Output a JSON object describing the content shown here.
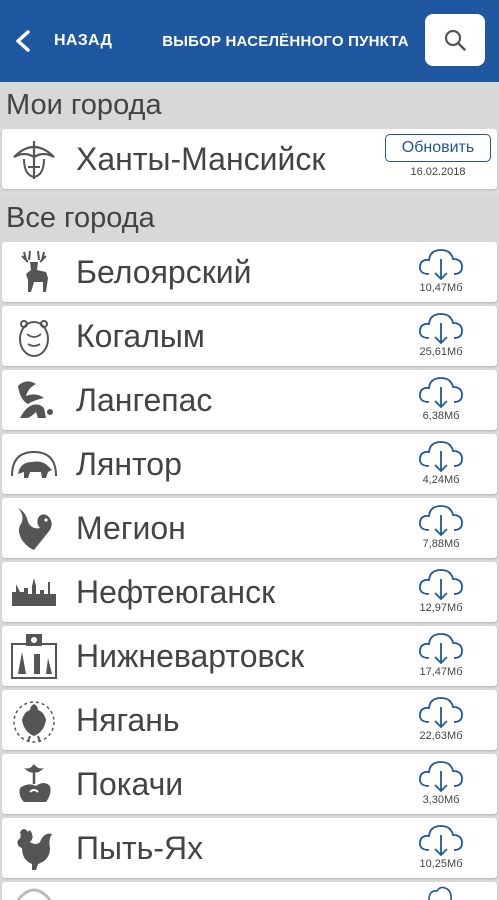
{
  "header": {
    "back_label": "НАЗАД",
    "title": "ВЫБОР НАСЕЛЁННОГО ПУНКТА",
    "accent_color": "#1f57a0"
  },
  "my_cities": {
    "title": "Мои города",
    "items": [
      {
        "name": "Ханты-Мансийск",
        "update_label": "Обновить",
        "date": "16.02.2018",
        "icon": "khanty-mansiysk-emblem-icon"
      }
    ]
  },
  "all_cities": {
    "title": "Все города",
    "items": [
      {
        "name": "Белоярский",
        "size": "10,47Мб",
        "icon": "deer-icon"
      },
      {
        "name": "Когалым",
        "size": "25,61Мб",
        "icon": "bear-icon"
      },
      {
        "name": "Лангепас",
        "size": "6,38Мб",
        "icon": "squirrel-icon"
      },
      {
        "name": "Лянтор",
        "size": "4,24Мб",
        "icon": "bear-walking-icon"
      },
      {
        "name": "Мегион",
        "size": "7,88Мб",
        "icon": "bird-icon"
      },
      {
        "name": "Нефтеюганск",
        "size": "12,97Мб",
        "icon": "skyline-icon"
      },
      {
        "name": "Нижневартовск",
        "size": "17,47Мб",
        "icon": "city-emblem-icon"
      },
      {
        "name": "Нягань",
        "size": "22,63Мб",
        "icon": "grouse-icon"
      },
      {
        "name": "Покачи",
        "size": "3,30Мб",
        "icon": "fountain-icon"
      },
      {
        "name": "Пыть-Ях",
        "size": "10,25Мб",
        "icon": "rooster-icon"
      }
    ]
  }
}
